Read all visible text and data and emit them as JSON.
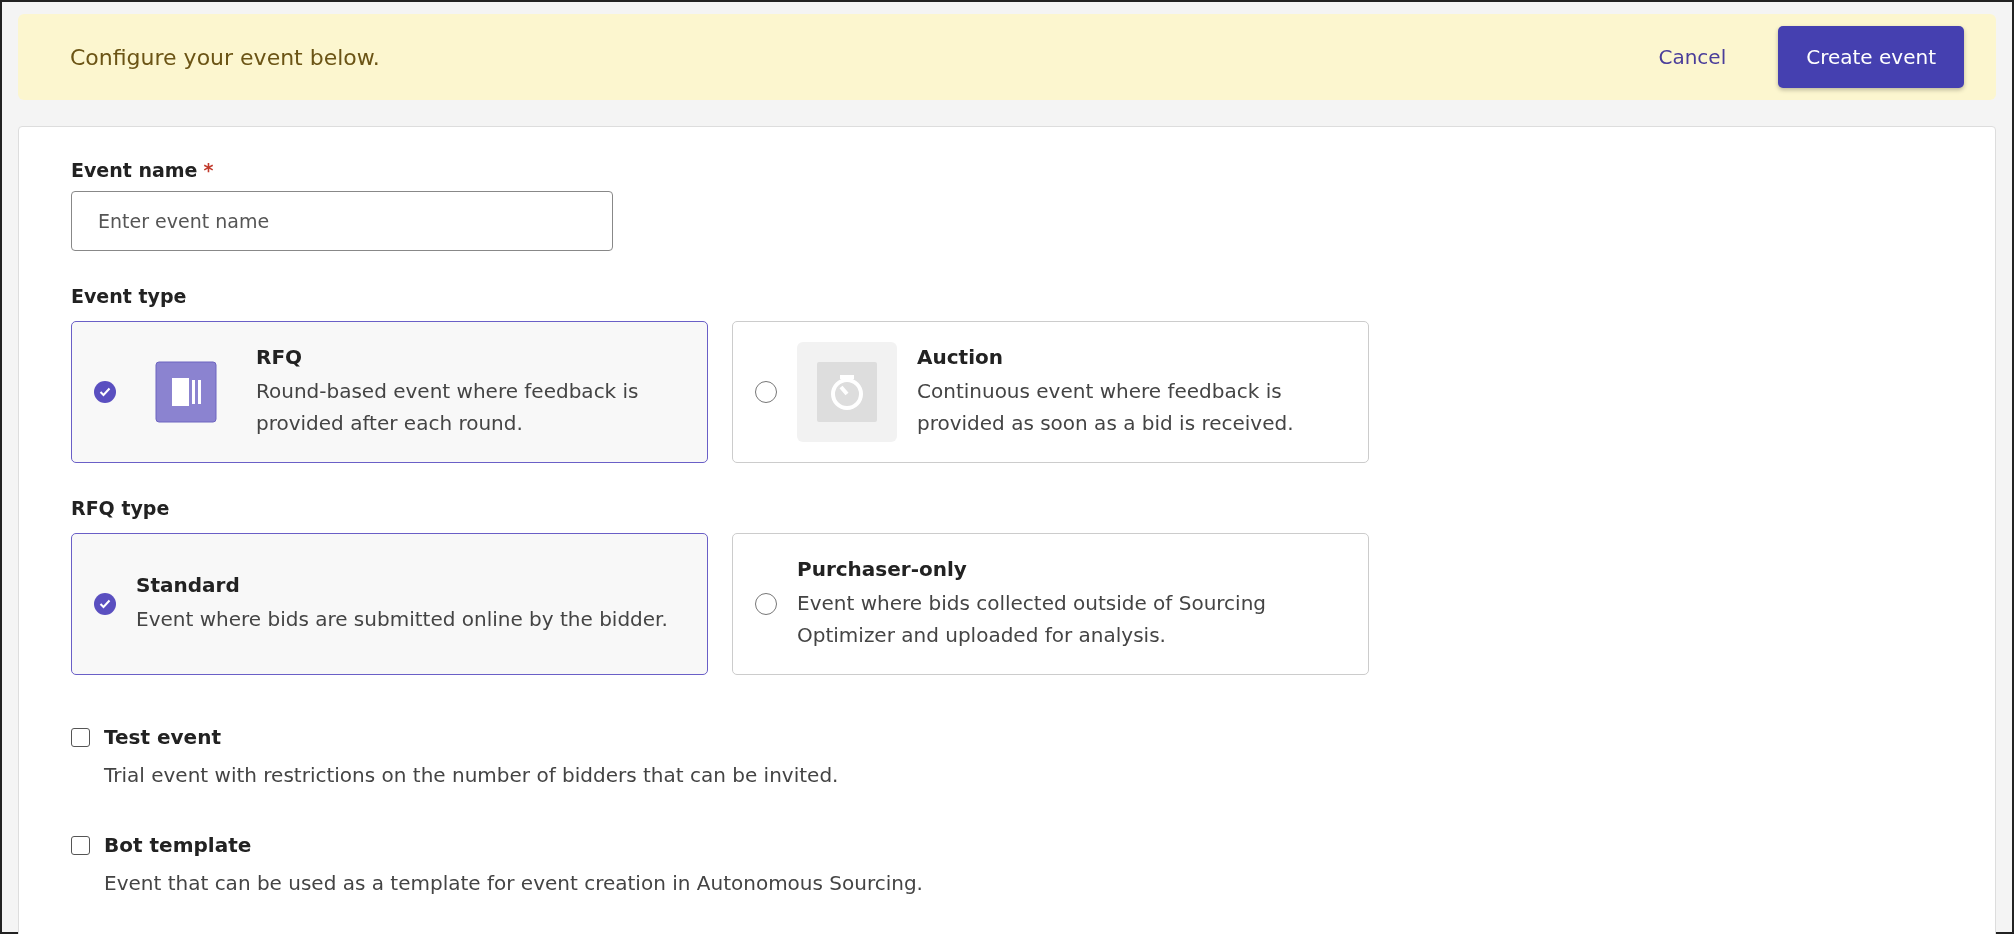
{
  "banner": {
    "message": "Configure your event below.",
    "cancel": "Cancel",
    "create": "Create event"
  },
  "event_name": {
    "label": "Event name",
    "required_mark": "*",
    "placeholder": "Enter event name"
  },
  "event_type": {
    "label": "Event type",
    "options": [
      {
        "title": "RFQ",
        "description": "Round-based event where feedback is provided after each round.",
        "selected": true,
        "kind": "rounds"
      },
      {
        "title": "Auction",
        "description": "Continuous event where feedback is provided as soon as a bid is received.",
        "selected": false,
        "kind": "timer"
      }
    ]
  },
  "rfq_type": {
    "label": "RFQ type",
    "options": [
      {
        "title": "Standard",
        "description": "Event where bids are submitted online by the bidder.",
        "selected": true
      },
      {
        "title": "Purchaser-only",
        "description": "Event where bids collected outside of Sourcing Optimizer and uploaded for analysis.",
        "selected": false
      }
    ]
  },
  "checkboxes": [
    {
      "label": "Test event",
      "description": "Trial event with restrictions on the number of bidders that can be invited.",
      "checked": false
    },
    {
      "label": "Bot template",
      "description": "Event that can be used as a template for event creation in Autonomous Sourcing.",
      "checked": false
    }
  ]
}
